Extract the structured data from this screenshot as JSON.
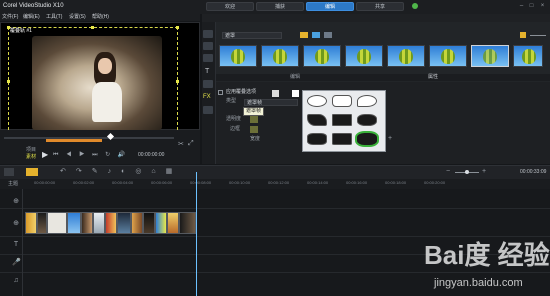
{
  "app": {
    "title": "Corel VideoStudio X10",
    "menu": [
      "文件(F)",
      "编辑(E)",
      "工具(T)",
      "设置(S)",
      "帮助(H)"
    ],
    "tabs": [
      "欢迎",
      "捕获",
      "编辑",
      "共享"
    ],
    "active_tab": "编辑"
  },
  "player": {
    "overlay_label": "覆叠轨 #1",
    "mode_labels": [
      "项目",
      "素材"
    ],
    "timecode": "00:00:00:00"
  },
  "library": {
    "dropdown": "遮罩",
    "thumb_count": 10
  },
  "options": {
    "checkbox_label": "应用覆叠选项",
    "type_label": "类型",
    "type_value": "遮罩帧",
    "tooltip": "遮罩帧",
    "row_labels": [
      "透明度",
      "边框",
      "宽度"
    ],
    "tabs": [
      "编辑",
      "属性"
    ]
  },
  "timeline": {
    "ruler_ticks": [
      "00:00:00:00",
      "00:00:02:00",
      "00:00:04:00",
      "00:00:06:00",
      "00:00:08:00",
      "00:00:10:00",
      "00:00:12:00",
      "00:00:14:00",
      "00:00:16:00",
      "00:00:18:00",
      "00:00:20:00"
    ],
    "track_name": "主题",
    "end_timecode": "00:00:33:09"
  },
  "watermark": {
    "brand": "Bai度 经验",
    "url": "jingyan.baidu.com"
  },
  "colors": {
    "accent": "#2d79c7",
    "highlight": "#e8e84a",
    "playhead": "#6cc1ff"
  }
}
